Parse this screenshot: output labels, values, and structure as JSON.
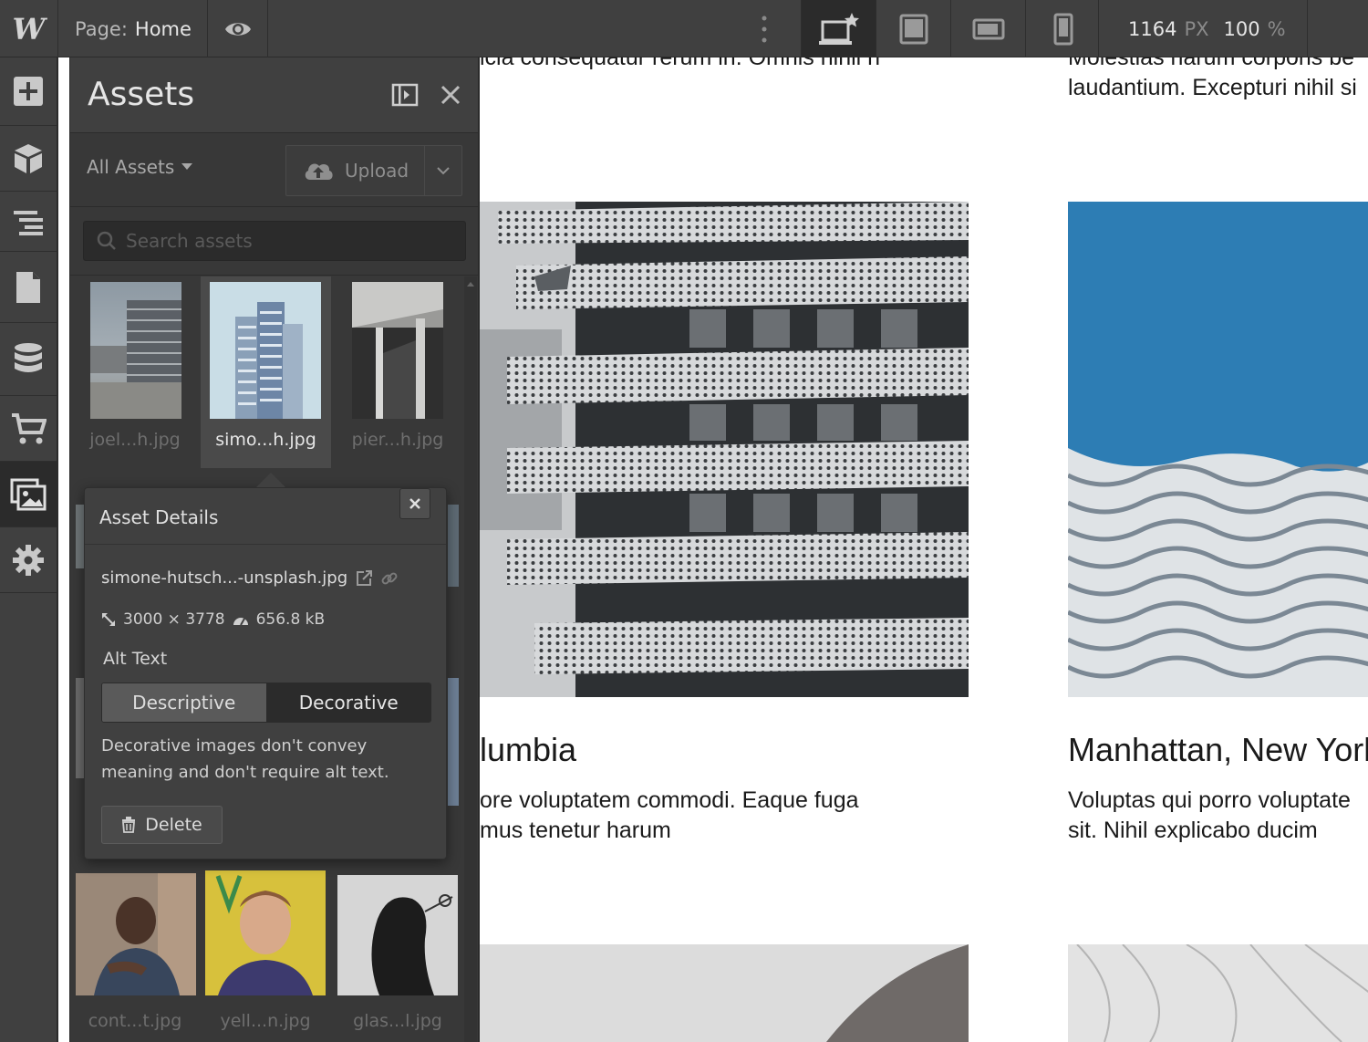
{
  "topbar": {
    "logo": "W",
    "page_prefix": "Page:",
    "page_name": "Home",
    "width_value": "1164",
    "width_unit": "PX",
    "zoom_value": "100",
    "zoom_unit": "%"
  },
  "assets_panel": {
    "title": "Assets",
    "filter_label": "All Assets",
    "upload_label": "Upload",
    "search_placeholder": "Search assets",
    "assets": [
      {
        "name": "joel...h.jpg"
      },
      {
        "name": "simo...h.jpg"
      },
      {
        "name": "pier...h.jpg"
      },
      {
        "name": "cont...t.jpg"
      },
      {
        "name": "yell...n.jpg"
      },
      {
        "name": "glas...l.jpg"
      }
    ]
  },
  "asset_details": {
    "title": "Asset Details",
    "filename": "simone-hutsch...-unsplash.jpg",
    "dimensions": "3000 × 3778",
    "filesize": "656.8 kB",
    "alt_text_label": "Alt Text",
    "alt_options": [
      "Descriptive",
      "Decorative"
    ],
    "selected_option": "Decorative",
    "help_text": "Decorative images don't convey meaning and don't require alt text.",
    "delete_label": "Delete"
  },
  "canvas": {
    "top_left_text": "icia consequatur rerum in. Omnis nihil n",
    "top_right_line1": "Molestias harum corporis be",
    "top_right_line2": "laudantium. Excepturi nihil si",
    "card1_title": "lumbia",
    "card1_line1": "ore voluptatem commodi. Eaque fuga",
    "card1_line2": "mus tenetur harum",
    "card2_title": "Manhattan, New York",
    "card2_line1": "Voluptas qui porro voluptate",
    "card2_line2": "sit. Nihil explicabo ducim"
  },
  "colors": {
    "chrome_bg": "#404040",
    "chrome_dark": "#2b2b2b",
    "panel_bg": "#383838",
    "text_light": "#e6e6e6",
    "sky_blue": "#2a7fb6"
  }
}
